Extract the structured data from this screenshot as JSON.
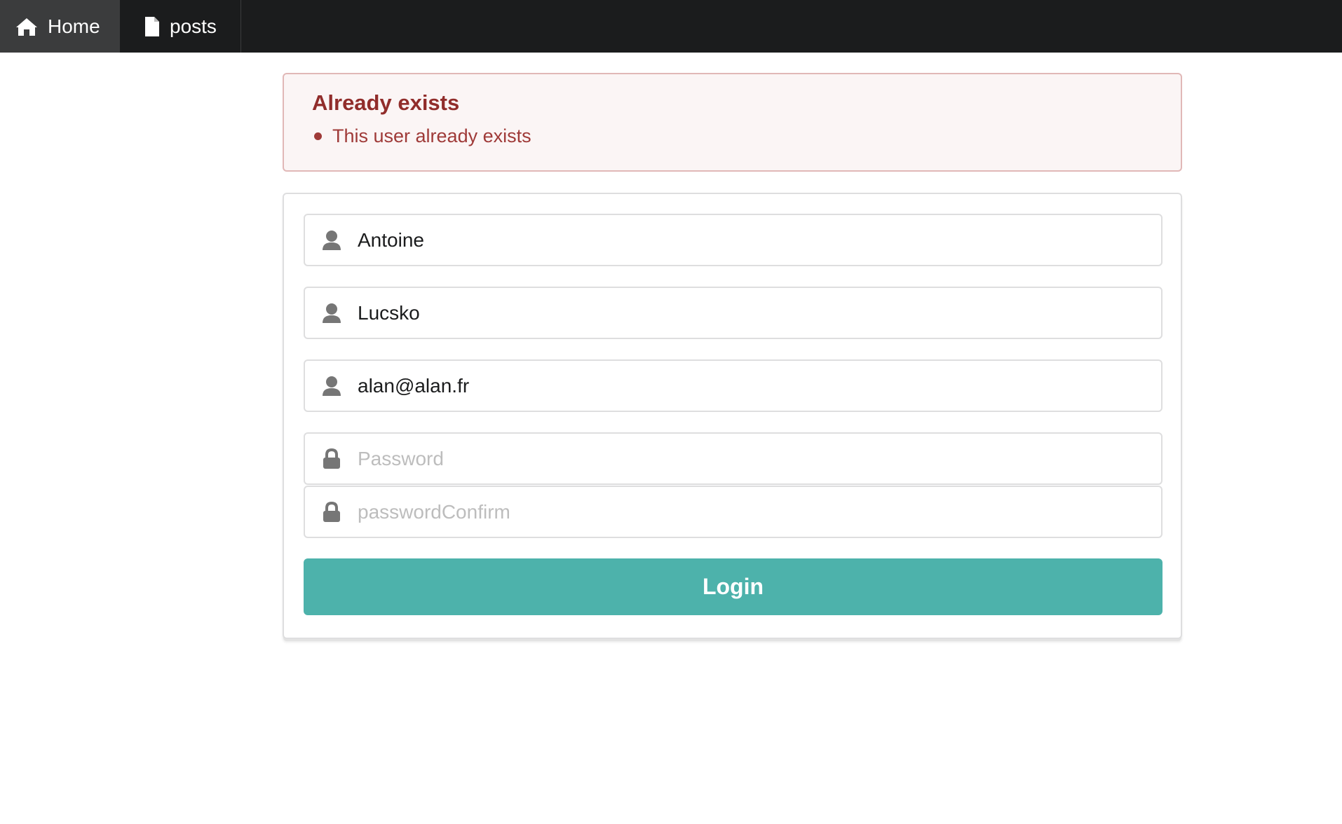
{
  "nav": {
    "items": [
      {
        "label": "Home",
        "icon": "home-icon",
        "active": true
      },
      {
        "label": "posts",
        "icon": "file-icon",
        "active": false
      }
    ]
  },
  "error": {
    "title": "Already exists",
    "messages": [
      "This user already exists"
    ]
  },
  "form": {
    "firstname": {
      "value": "Antoine",
      "icon": "user-icon"
    },
    "lastname": {
      "value": "Lucsko",
      "icon": "user-icon"
    },
    "email": {
      "value": "alan@alan.fr",
      "icon": "user-icon"
    },
    "password": {
      "value": "",
      "placeholder": "Password",
      "icon": "lock-icon"
    },
    "password_confirm": {
      "value": "",
      "placeholder": "passwordConfirm",
      "icon": "lock-icon"
    },
    "submit_label": "Login"
  },
  "colors": {
    "navbar": "#1b1c1d",
    "error_title": "#912d2b",
    "error_text": "#9f3a38",
    "error_bg": "#fbf5f5",
    "button": "#4db2ab"
  }
}
